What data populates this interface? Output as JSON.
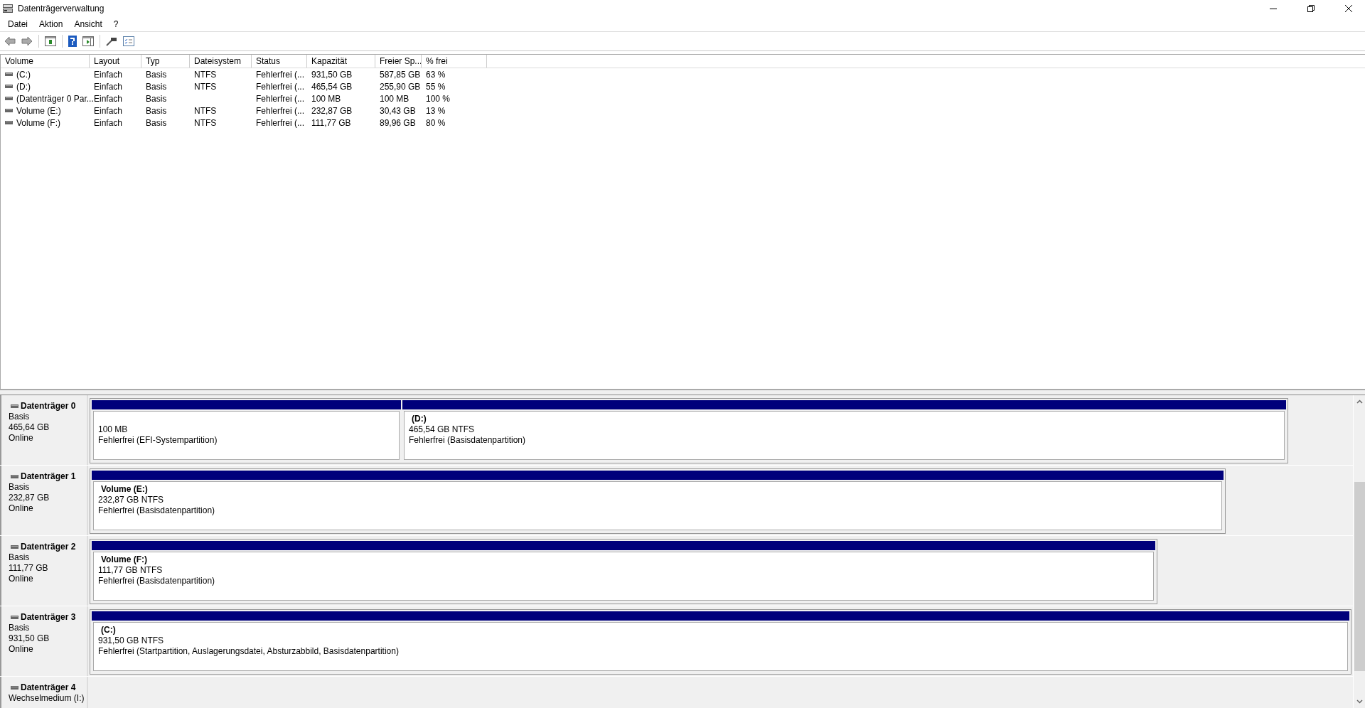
{
  "window": {
    "title": "Datenträgerverwaltung"
  },
  "menu": [
    "Datei",
    "Aktion",
    "Ansicht",
    "?"
  ],
  "table": {
    "columns": [
      "Volume",
      "Layout",
      "Typ",
      "Dateisystem",
      "Status",
      "Kapazität",
      "Freier Sp...",
      "% frei"
    ],
    "rows": [
      [
        "(C:)",
        "Einfach",
        "Basis",
        "NTFS",
        "Fehlerfrei (...",
        "931,50 GB",
        "587,85 GB",
        "63 %"
      ],
      [
        "(D:)",
        "Einfach",
        "Basis",
        "NTFS",
        "Fehlerfrei (...",
        "465,54 GB",
        "255,90 GB",
        "55 %"
      ],
      [
        "(Datenträger 0 Par...",
        "Einfach",
        "Basis",
        "",
        "Fehlerfrei (...",
        "100 MB",
        "100 MB",
        "100 %"
      ],
      [
        "Volume (E:)",
        "Einfach",
        "Basis",
        "NTFS",
        "Fehlerfrei (...",
        "232,87 GB",
        "30,43 GB",
        "13 %"
      ],
      [
        "Volume (F:)",
        "Einfach",
        "Basis",
        "NTFS",
        "Fehlerfrei (...",
        "111,77 GB",
        "89,96 GB",
        "80 %"
      ]
    ]
  },
  "disks": [
    {
      "name": "Datenträger 0",
      "details": [
        "Basis",
        "465,64 GB",
        "Online"
      ],
      "partitions": [
        {
          "size": "100 MB",
          "status": "Fehlerfrei (EFI-Systempartition)"
        },
        {
          "title": "(D:)",
          "size": "465,54 GB NTFS",
          "status": "Fehlerfrei (Basisdatenpartition)"
        }
      ]
    },
    {
      "name": "Datenträger 1",
      "details": [
        "Basis",
        "232,87 GB",
        "Online"
      ],
      "partitions": [
        {
          "title": "Volume  (E:)",
          "size": "232,87 GB NTFS",
          "status": "Fehlerfrei (Basisdatenpartition)"
        }
      ]
    },
    {
      "name": "Datenträger 2",
      "details": [
        "Basis",
        "111,77 GB",
        "Online"
      ],
      "partitions": [
        {
          "title": "Volume  (F:)",
          "size": "111,77 GB NTFS",
          "status": "Fehlerfrei (Basisdatenpartition)"
        }
      ]
    },
    {
      "name": "Datenträger 3",
      "details": [
        "Basis",
        "931,50 GB",
        "Online"
      ],
      "partitions": [
        {
          "title": "(C:)",
          "size": "931,50 GB NTFS",
          "status": "Fehlerfrei (Startpartition, Auslagerungsdatei, Absturzabbild, Basisdatenpartition)"
        }
      ]
    },
    {
      "name": "Datenträger 4",
      "details": [
        "Wechselmedium (I:)"
      ]
    }
  ]
}
